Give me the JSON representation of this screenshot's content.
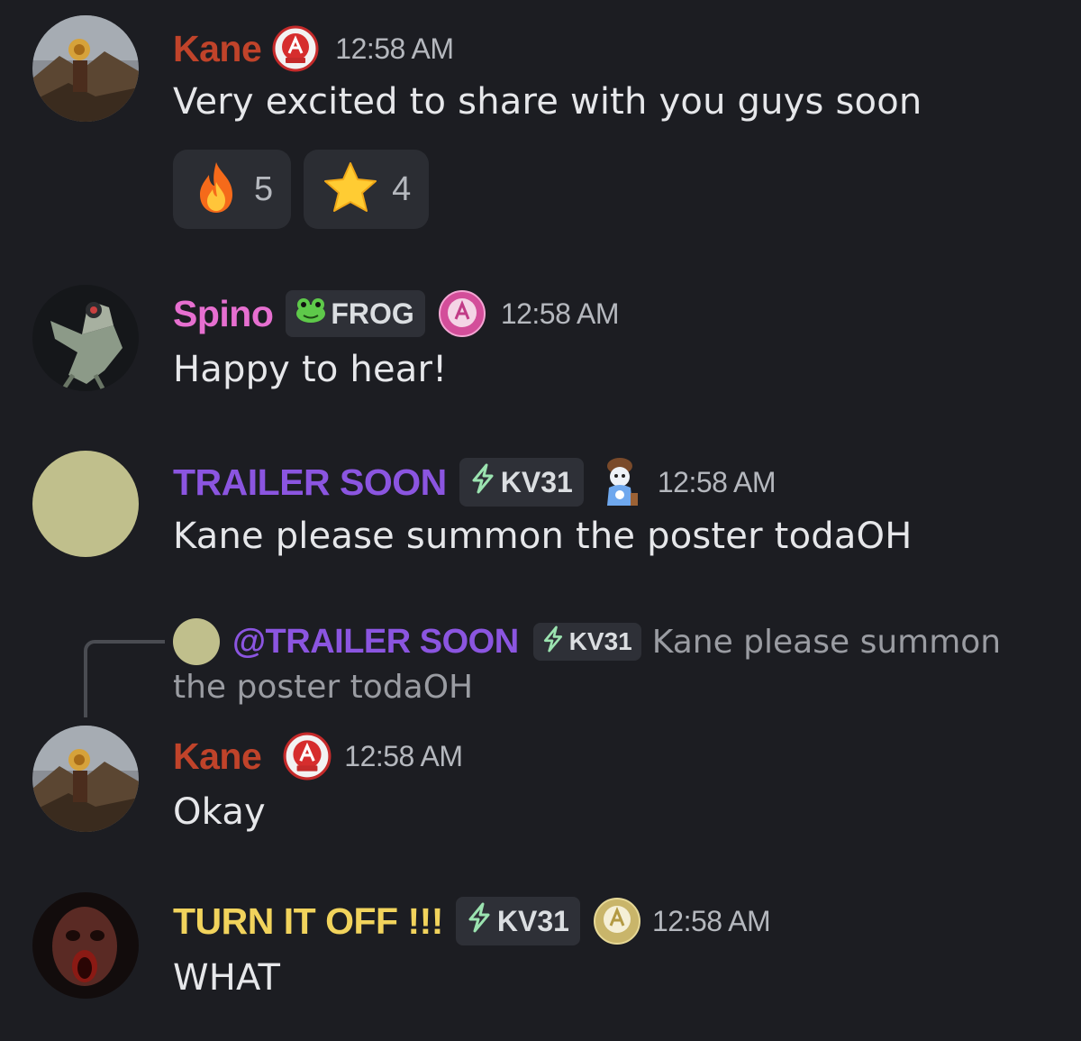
{
  "messages": [
    {
      "username": "Kane",
      "username_color": "#c0432a",
      "timestamp": "12:58 AM",
      "text": "Very excited to share with you guys soon",
      "reactions": [
        {
          "emoji": "🔥",
          "icon": "fire-emoji",
          "count": "5"
        },
        {
          "emoji": "⭐",
          "icon": "star-emoji",
          "count": "4"
        }
      ]
    },
    {
      "username": "Spino",
      "username_color": "#e66fd0",
      "tag": "FROG",
      "tag_icon": "frog-icon",
      "timestamp": "12:58 AM",
      "text": "Happy to hear!"
    },
    {
      "username": "TRAILER SOON",
      "username_color": "#8b55e0",
      "tag": "KV31",
      "tag_icon": "lightning-icon",
      "timestamp": "12:58 AM",
      "text": "Kane please summon the poster todaOH"
    },
    {
      "reply": {
        "mention": "@TRAILER SOON",
        "tag": "KV31",
        "text_line1": "Kane please summon",
        "text_line2": "the poster todaOH"
      },
      "username": "Kane",
      "username_color": "#c0432a",
      "timestamp": "12:58 AM",
      "text": "Okay"
    },
    {
      "username": "TURN IT OFF !!!",
      "username_color": "#f1d35c",
      "tag": "KV31",
      "tag_icon": "lightning-icon",
      "timestamp": "12:58 AM",
      "text": "WHAT"
    }
  ]
}
